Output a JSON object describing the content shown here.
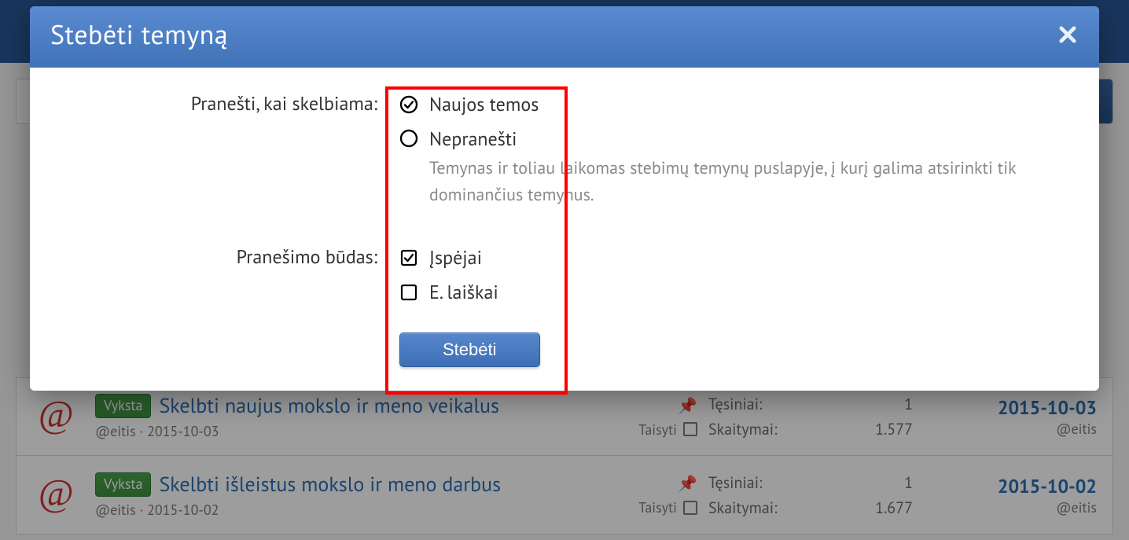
{
  "modal": {
    "title": "Stebėti temyną",
    "label_notify_when": "Pranešti, kai skelbiama:",
    "opt_new_topics": "Naujos temos",
    "opt_no_notify": "Nepranešti",
    "opt_no_notify_help": "Temynas ir toliau laikomas stebimų temynų puslapyje, į kurį galima atsirinkti tik dominančius temynus.",
    "label_method": "Pranešimo būdas:",
    "opt_alerts": "Įspėjai",
    "opt_emails": "E. laiškai",
    "submit": "Stebėti"
  },
  "threads": [
    {
      "badge": "Vyksta",
      "title": "Skelbti naujus mokslo ir meno veikalus",
      "author": "@eitis",
      "started": "2015-10-03",
      "edit": "Taisyti",
      "stat_replies_label": "Tęsiniai:",
      "stat_replies": "1",
      "stat_views_label": "Skaitymai:",
      "stat_views": "1.577",
      "latest_date": "2015-10-03",
      "latest_by": "@eitis"
    },
    {
      "badge": "Vyksta",
      "title": "Skelbti išleistus mokslo ir meno darbus",
      "author": "@eitis",
      "started": "2015-10-02",
      "edit": "Taisyti",
      "stat_replies_label": "Tęsiniai:",
      "stat_replies": "1",
      "stat_views_label": "Skaitymai:",
      "stat_views": "1.677",
      "latest_date": "2015-10-02",
      "latest_by": "@eitis"
    }
  ]
}
